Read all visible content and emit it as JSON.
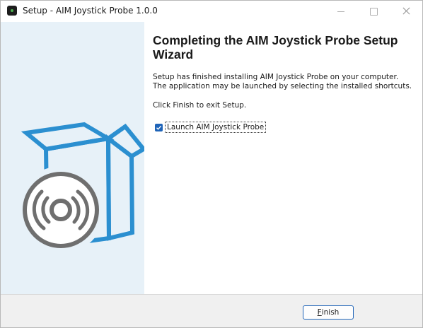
{
  "window": {
    "title": "Setup - AIM Joystick Probe 1.0.0",
    "app_icon": "app-icon"
  },
  "page": {
    "heading": "Completing the AIM Joystick Probe Setup Wizard",
    "description": "Setup has finished installing AIM Joystick Probe on your computer. The application may be launched by selecting the installed shortcuts.",
    "instruction": "Click Finish to exit Setup.",
    "launch_checkbox": {
      "label": "Launch AIM Joystick Probe",
      "checked": true
    }
  },
  "footer": {
    "finish_label_accel": "F",
    "finish_label_rest": "inish"
  },
  "colors": {
    "banner_background": "#e7f1f8",
    "box_stroke": "#2b8fd0",
    "disc": "#6f6f6f",
    "accent": "#1f64b8"
  }
}
